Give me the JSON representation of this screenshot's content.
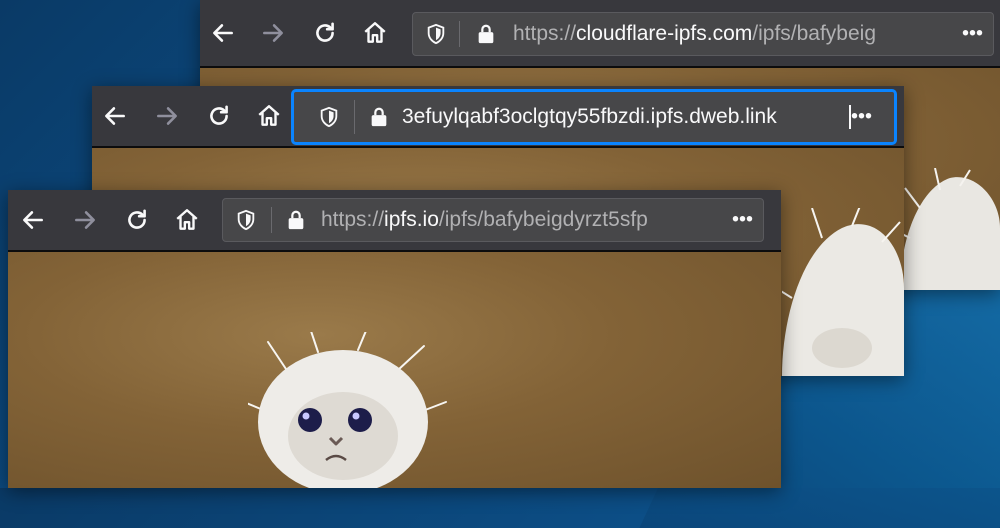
{
  "windows": [
    {
      "id": "cloudflare",
      "url_scheme": "https://",
      "url_host": "cloudflare-ipfs.com",
      "url_path": "/ipfs/bafybeig",
      "page_actions": "•••"
    },
    {
      "id": "dweb",
      "url_typed": "3efuylqabf3oclgtqy55fbzdi.ipfs.dweb.link",
      "page_actions": "•••"
    },
    {
      "id": "ipfs-io",
      "url_scheme": "https://",
      "url_host": "ipfs.io",
      "url_path": "/ipfs/bafybeigdyrzt5sfp",
      "page_actions": "•••"
    }
  ],
  "colors": {
    "toolbar": "#38383d",
    "urlbar": "#474749",
    "focus_ring": "#0a84ff",
    "desktop": "#0c4e86",
    "page_background": "#836337"
  },
  "icons": [
    "back-arrow-icon",
    "forward-arrow-icon",
    "reload-icon",
    "home-icon",
    "tracking-protection-shield-icon",
    "lock-icon",
    "page-actions-icon"
  ]
}
